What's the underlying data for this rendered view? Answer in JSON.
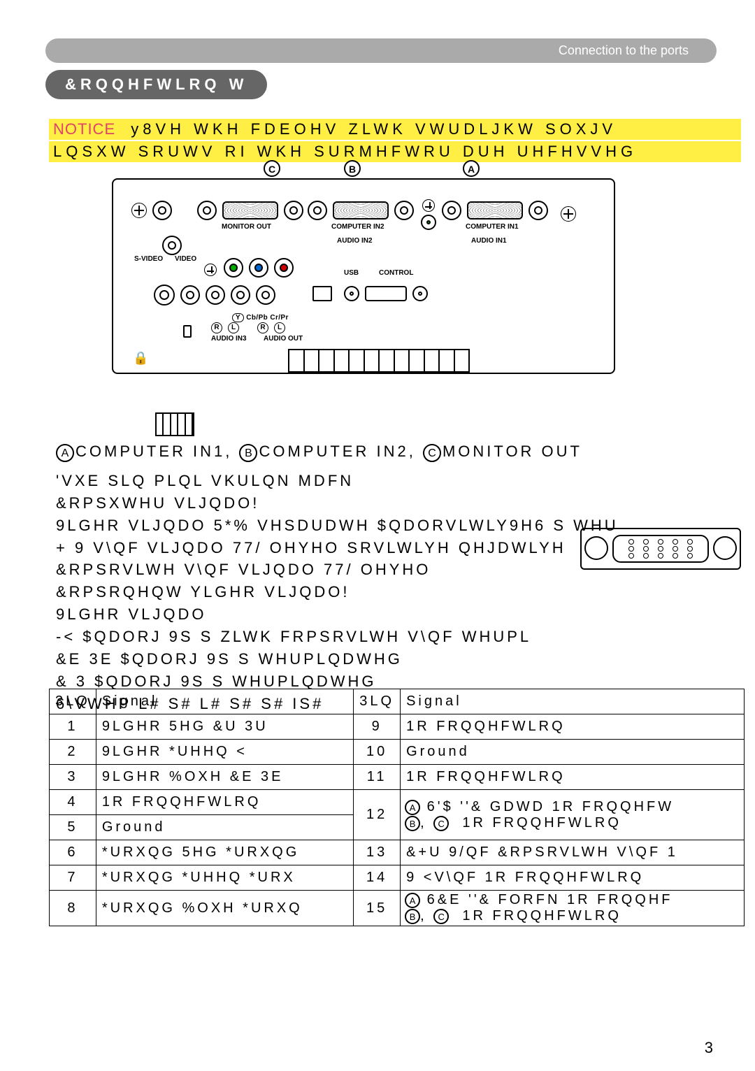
{
  "header": {
    "breadcrumb": "Connection to the ports",
    "title": "&RQQHFWLRQ W"
  },
  "notice": {
    "label": "NOTICE",
    "line1": "y8VH WKH FDEOHV ZLWK VWUDLJKW SOXJV",
    "line2": "LQSXW SRUWV RI WKH SURMHFWRU DUH UHFHVVHG"
  },
  "diagram": {
    "labels": {
      "monitor_out": "MONITOR OUT",
      "computer_in2": "COMPUTER IN2",
      "computer_in1": "COMPUTER IN1",
      "audio_in2": "AUDIO IN2",
      "audio_in1": "AUDIO IN1",
      "svideo": "S-VIDEO",
      "video": "VIDEO",
      "usb": "USB",
      "control": "CONTROL",
      "y": "Y",
      "cbcr": "Cb/Pb Cr/Pr",
      "r": "R",
      "l": "L",
      "audio_in3": "AUDIO IN3",
      "audio_out": "AUDIO OUT"
    },
    "callouts": {
      "a": "A",
      "b": "B",
      "c": "C"
    }
  },
  "section": {
    "heading": {
      "a": "COMPUTER IN1,",
      "b": "COMPUTER IN2,",
      "c": "MONITOR OUT"
    },
    "line1": "'VXE  SLQ PLQL VKULQN MDFN",
    "line2": "&RPSXWHU VLJQDO!",
    "line3": "9LGHR VLJQDO  5*%  VHSDUDWH  $QDORVLWLY9H6 S   WHU",
    "line4": " + 9  V\\QF  VLJQDO  77/ OHYHO  SRVLWLYH QHJDWLYH",
    "line5": " &RPSRVLWH V\\QF  VLJQDO  77/ OHYHO",
    "line6": "&RPSRQHQW YLGHR VLJQDO!",
    "line7": "9LGHR VLJQDO",
    "line8": " -< $QDORJ       9S S ZLWK FRPSRVLWH V\\QF   WHUPL",
    "line9": " &E 3E $QDORJ      9S S    WHUPLQDWHG",
    "line10": " & 3 $QDORJ       9S S   WHUPLQDWHG",
    "line11": "6\\VWHP   L#    S#    L#    S#    S#          IS#"
  },
  "table": {
    "head": {
      "pin": "3LQ",
      "signal": "Signal"
    },
    "left": [
      {
        "n": "1",
        "s": "9LGHR 5HG  &U 3U"
      },
      {
        "n": "2",
        "s": "9LGHR *UHHQ  <"
      },
      {
        "n": "3",
        "s": "9LGHR %OXH  &E 3E"
      },
      {
        "n": "4",
        "s": "1R FRQQHFWLRQ"
      },
      {
        "n": "5",
        "s": "Ground"
      },
      {
        "n": "6",
        "s": "*URXQG 5HG  *URXQG"
      },
      {
        "n": "7",
        "s": "*URXQG *UHHQ  *URX"
      },
      {
        "n": "8",
        "s": "*URXQG %OXH  *URXQ"
      }
    ],
    "right": [
      {
        "n": "9",
        "s": "1R FRQQHFWLRQ"
      },
      {
        "n": "10",
        "s": "Ground"
      },
      {
        "n": "11",
        "s": "1R FRQQHFWLRQ"
      },
      {
        "n": "12",
        "sa": "6'$ ''& GDWD   1R FRQQHFW",
        "sbc": "1R FRQQHFWLRQ"
      },
      {
        "n": "13",
        "s": "&+U 9/QF  &RPSRVLWH V\\QF  1"
      },
      {
        "n": "14",
        "s": "9 <V\\QF   1R FRQQHFWLRQ"
      },
      {
        "n": "15",
        "sa": "6&E ''& FORFN   1R FRQQHF",
        "sbc": "1R FRQQHFWLRQ"
      }
    ]
  },
  "page_number": "3"
}
